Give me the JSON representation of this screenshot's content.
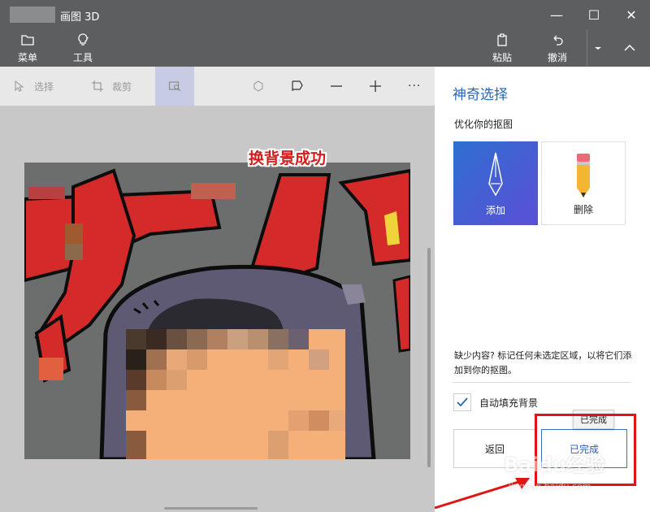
{
  "window": {
    "title": "画图 3D",
    "minimize": "—",
    "maximize": "☐",
    "close": "✕"
  },
  "ribbon": {
    "menu_label": "菜单",
    "tools_label": "工具",
    "paste_label": "粘贴",
    "undo_label": "撤消"
  },
  "toolbar": {
    "select_label": "选择",
    "crop_label": "裁剪",
    "more_label": "···"
  },
  "canvas": {
    "caption": "换背景成功"
  },
  "panel": {
    "title": "神奇选择",
    "subtitle": "优化你的抠图",
    "add_label": "添加",
    "remove_label": "删除",
    "hint": "缺少内容? 标记任何未选定区域，以将它们添加到你的抠图。",
    "autofill_label": "自动填充背景",
    "autofill_checked": true,
    "back_label": "返回",
    "done_label": "已完成",
    "done_tooltip": "已完成"
  },
  "watermark": {
    "logo": "Baidu经验",
    "url": "jingyan.baidu.com"
  },
  "colors": {
    "accent": "#2468b8",
    "annotation": "#e01414",
    "chrome": "#5c5e60"
  }
}
